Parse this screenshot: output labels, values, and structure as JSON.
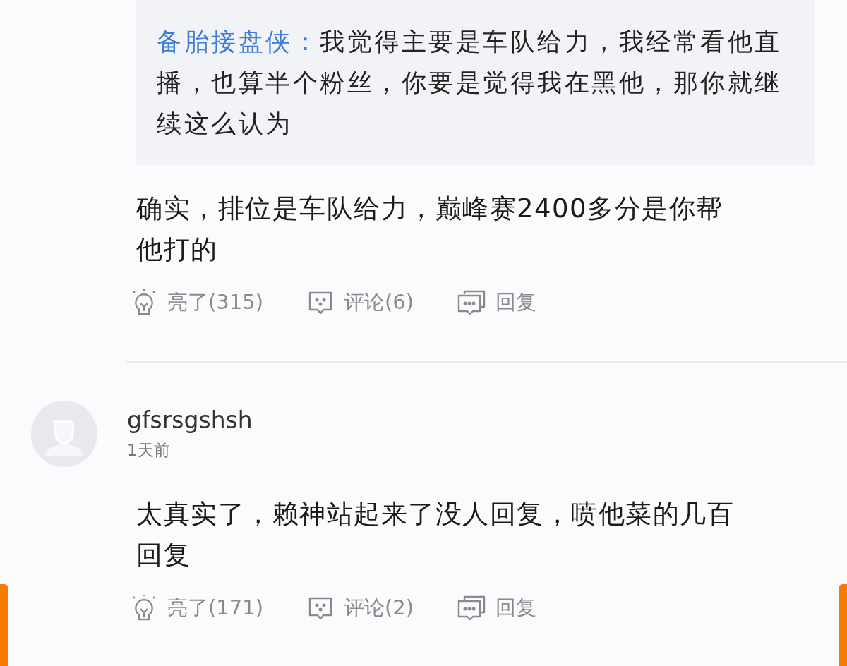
{
  "quote": {
    "author": "备胎接盘侠：",
    "text": "我觉得主要是车队给力，我经常看他直播，也算半个粉丝，你要是觉得我在黑他，那你就继续这么认为"
  },
  "comments": [
    {
      "text": "确实，排位是车队给力，巅峰赛2400多分是你帮他打的",
      "actions": [
        {
          "kind": "like",
          "label": "亮了(315)"
        },
        {
          "kind": "comment",
          "label": "评论(6)"
        },
        {
          "kind": "reply",
          "label": "回复"
        }
      ]
    },
    {
      "user": "gfsrsgshsh",
      "time": "1天前",
      "text": "太真实了，赖神站起来了没人回复，喷他菜的几百回复",
      "actions": [
        {
          "kind": "like",
          "label": "亮了(171)"
        },
        {
          "kind": "comment",
          "label": "评论(2)"
        },
        {
          "kind": "reply",
          "label": "回复"
        }
      ]
    }
  ]
}
